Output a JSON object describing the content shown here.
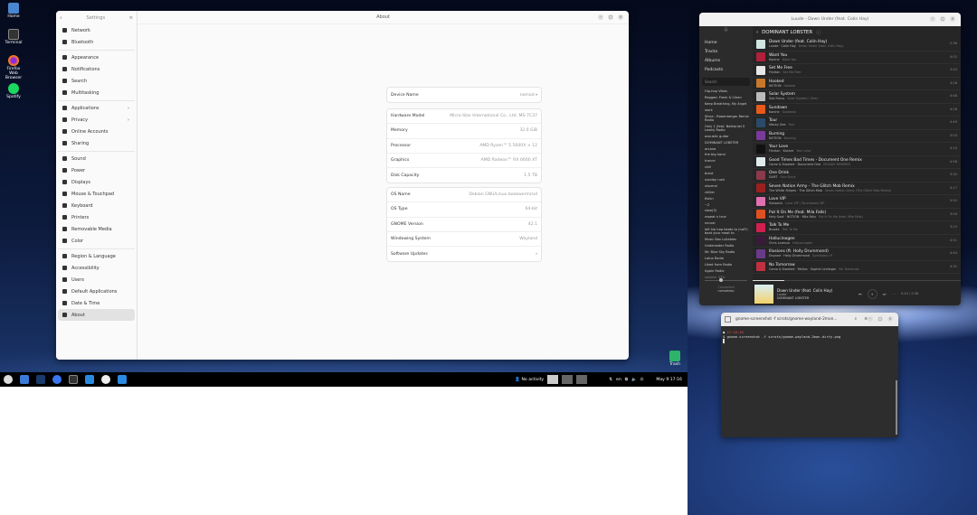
{
  "desktop": {
    "icons": [
      {
        "label": "Home",
        "color": "#4a86cf"
      },
      {
        "label": "Terminal",
        "color": "#333"
      },
      {
        "label": "Firefox Web Browser",
        "color": "#ff7a1a"
      },
      {
        "label": "Spotify",
        "color": "#1ed760"
      }
    ],
    "trash": "Trash"
  },
  "settings": {
    "sidebar_title": "Settings",
    "main_title": "About",
    "groups": [
      [
        {
          "label": "Network"
        },
        {
          "label": "Bluetooth"
        }
      ],
      [
        {
          "label": "Appearance"
        },
        {
          "label": "Notifications"
        },
        {
          "label": "Search"
        },
        {
          "label": "Multitasking"
        }
      ],
      [
        {
          "label": "Applications",
          "chevron": true
        },
        {
          "label": "Privacy",
          "chevron": true
        },
        {
          "label": "Online Accounts"
        },
        {
          "label": "Sharing"
        }
      ],
      [
        {
          "label": "Sound"
        },
        {
          "label": "Power"
        },
        {
          "label": "Displays"
        },
        {
          "label": "Mouse & Touchpad"
        },
        {
          "label": "Keyboard"
        },
        {
          "label": "Printers"
        },
        {
          "label": "Removable Media"
        },
        {
          "label": "Color"
        }
      ],
      [
        {
          "label": "Region & Language"
        },
        {
          "label": "Accessibility"
        },
        {
          "label": "Users"
        },
        {
          "label": "Default Applications"
        },
        {
          "label": "Date & Time"
        },
        {
          "label": "About",
          "active": true
        }
      ]
    ],
    "device": {
      "label": "Device Name",
      "value": "nomad"
    },
    "hardware": [
      {
        "label": "Hardware Model",
        "value": "Micro-Star International Co., Ltd. MS-7C37"
      },
      {
        "label": "Memory",
        "value": "32.0 GiB"
      },
      {
        "label": "Processor",
        "value": "AMD Ryzen™ 5 5600X × 12"
      },
      {
        "label": "Graphics",
        "value": "AMD Radeon™ RX 6600 XT"
      },
      {
        "label": "Disk Capacity",
        "value": "1.5 TB"
      }
    ],
    "os": [
      {
        "label": "OS Name",
        "value": "Debian GNU/Linux bookworm/sid"
      },
      {
        "label": "OS Type",
        "value": "64-bit"
      },
      {
        "label": "GNOME Version",
        "value": "42.1"
      },
      {
        "label": "Windowing System",
        "value": "Wayland"
      },
      {
        "label": "Software Updates",
        "value": "›"
      }
    ]
  },
  "music": {
    "title": "Luude - Down Under (feat. Colin Hay)",
    "nav": [
      "Home",
      "Tracks",
      "Albums",
      "Podcasts"
    ],
    "search_placeholder": "Search",
    "playlist_title": "DOMINANT LOBSTER",
    "playlists": [
      "Hip-hop Vibes",
      "Reggae: Fresh & Clean",
      "Keep Breathing, My Angel",
      "work",
      "Silvia - Rabenberger Remix Radio",
      "Only 1 (feat. Nathaniel S Lewis) Radio",
      "acoustic guitar",
      "DOMINANT LOBSTER",
      "arcana",
      "the big hand",
      "trance",
      "chill",
      "brext",
      "sunday rush",
      "visceral",
      "chiller",
      "fishin",
      "~2",
      "slow(3)",
      "repeat n true",
      "neural",
      "lofi hip hop beats to (not?) beat your meat to",
      "Music Box Lullabies",
      "Underwater Radio",
      "Mr. Blue Sky Radio",
      "Lotus Radio",
      "Liked from Radio",
      "Again Radio"
    ],
    "volume": "volume: 33%",
    "volume_level": 0.33,
    "connection": "Connected",
    "device": "nomadeep",
    "tracks": [
      {
        "title": "Down Under (feat. Colin Hay)",
        "artists": "Luude · Colin Hay",
        "album": "Down Under (feat. Colin Hay)",
        "duration": "2:38",
        "color": "#cfe6e0"
      },
      {
        "title": "Want You",
        "artists": "Kanine",
        "album": "Want You",
        "duration": "4:02",
        "color": "#b0203a"
      },
      {
        "title": "Set Me Free",
        "artists": "Friction",
        "album": "Set Me Free",
        "duration": "3:43",
        "color": "#e8e8e8"
      },
      {
        "title": "Hooked",
        "artists": "NOTION",
        "album": "Hooked",
        "duration": "3:26",
        "color": "#c8782a"
      },
      {
        "title": "Solar System",
        "artists": "Sub Focus",
        "album": "Solar System / Siren",
        "duration": "4:48",
        "color": "#bbbbbb"
      },
      {
        "title": "Sundown",
        "artists": "Kanine",
        "album": "Sundown",
        "duration": "4:28",
        "color": "#e85a1a"
      },
      {
        "title": "Tour",
        "artists": "Macky Gee",
        "album": "Tour",
        "duration": "4:49",
        "color": "#2a4a6a"
      },
      {
        "title": "Burning",
        "artists": "NOTION",
        "album": "Burning",
        "duration": "3:03",
        "color": "#7a3a9a"
      },
      {
        "title": "Your Love",
        "artists": "Friction · Kanine",
        "album": "Your Love",
        "duration": "4:10",
        "color": "#111111"
      },
      {
        "title": "Good Times Bad Times - Document One Remix",
        "artists": "Camo & Krooked · Document One",
        "album": "MOSAIK REMIXED",
        "duration": "4:58",
        "color": "#e0ecec"
      },
      {
        "title": "One Drink",
        "artists": "DLMT",
        "album": "One Drink",
        "duration": "3:32",
        "color": "#8a3a4a"
      },
      {
        "title": "Seven Nation Army - The Glitch Mob Remix",
        "artists": "The White Stripes · The Glitch Mob",
        "album": "Seven Nation Army (The Glitch Mob Remix)",
        "duration": "4:17",
        "color": "#9a2020"
      },
      {
        "title": "Love VIP",
        "artists": "Subsonic",
        "album": "Love VIP / Touchdown VIP",
        "duration": "3:52",
        "color": "#e070b0"
      },
      {
        "title": "Put It On Me (feat. Mila Falls)",
        "artists": "Holy Goof · NOTION · Mila Falls",
        "album": "Put It On Me (feat. Mila Falls)",
        "duration": "3:04",
        "color": "#e05020"
      },
      {
        "title": "Talk To Me",
        "artists": "Brooks",
        "album": "Talk To Me",
        "duration": "3:23",
        "color": "#d02050"
      },
      {
        "title": "Hallucinogen",
        "artists": "Chris Lorenzo",
        "album": "Hallucinogen",
        "duration": "4:51",
        "color": "#3a1a3a"
      },
      {
        "title": "Illusions (ft. Holly Drummond)",
        "artists": "Dnyone · Holly Drummond",
        "album": "Symbiosis LP",
        "duration": "4:44",
        "color": "#6a3a8a"
      },
      {
        "title": "No Tomorrow",
        "artists": "Camo & Krooked · Mefjus · Sophie Lindinger",
        "album": "No Tomorrow",
        "duration": "4:31",
        "color": "#c03040"
      }
    ],
    "now_playing": {
      "title": "Down Under (feat. Colin Hay)",
      "artist": "Luude",
      "playlist": "DOMINANT LOBSTER",
      "time": "0:24 / 2:38",
      "progress": 0.15
    }
  },
  "terminal": {
    "title": "gnome-screenshot -f scrots/gnome-wayland-2mon...",
    "time": "17:16:36",
    "prompt": "$",
    "command": "gnome-screenshot -f scrots/gnome-wayland-2mon-dirty.png"
  },
  "taskbar": {
    "apps": [
      {
        "name": "debian",
        "color": "#ddd"
      },
      {
        "name": "files",
        "color": "#3a7ad8"
      },
      {
        "name": "steam",
        "color": "#1a3a6a"
      },
      {
        "name": "signal",
        "color": "#3a76f0"
      },
      {
        "name": "terminal",
        "color": "#333"
      },
      {
        "name": "visual-studio-code",
        "color": "#2a8ae0"
      },
      {
        "name": "settings",
        "color": "#eee"
      },
      {
        "name": "visual-studio-code-2",
        "color": "#2a8ae0"
      }
    ],
    "activity": "No activity",
    "keyboard": "en",
    "clock": "May 9  17:16"
  }
}
